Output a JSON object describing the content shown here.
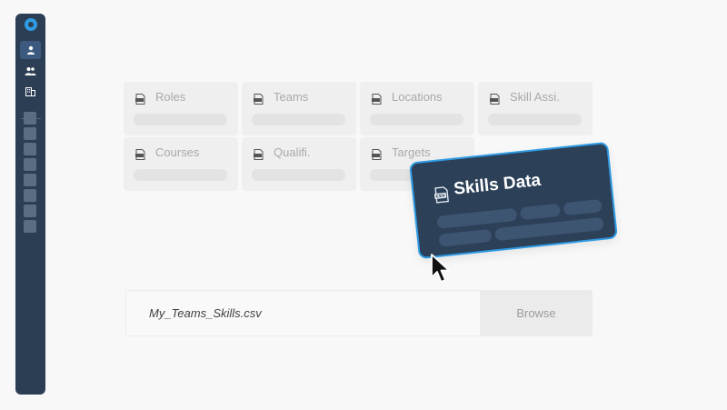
{
  "sidebar": {
    "logo": "app-logo",
    "nav_icons": [
      "user-icon",
      "team-icon",
      "building-icon"
    ],
    "placeholder_count": 8
  },
  "tiles": [
    {
      "label": "Roles",
      "icon": "csv-file-icon"
    },
    {
      "label": "Teams",
      "icon": "csv-file-icon"
    },
    {
      "label": "Locations",
      "icon": "csv-file-icon"
    },
    {
      "label": "Skill Assi.",
      "icon": "csv-file-icon"
    },
    {
      "label": "Courses",
      "icon": "csv-file-icon"
    },
    {
      "label": "Qualifi.",
      "icon": "csv-file-icon"
    },
    {
      "label": "Targets",
      "icon": "csv-file-icon"
    }
  ],
  "drag_card": {
    "title": "Skills Data",
    "icon": "csv-file-icon"
  },
  "file_input": {
    "value": "My_Teams_Skills.csv",
    "browse_label": "Browse"
  },
  "colors": {
    "sidebar": "#2c3e54",
    "accent": "#2f9be3",
    "card": "#2c4058",
    "background": "#f8f8f8"
  }
}
